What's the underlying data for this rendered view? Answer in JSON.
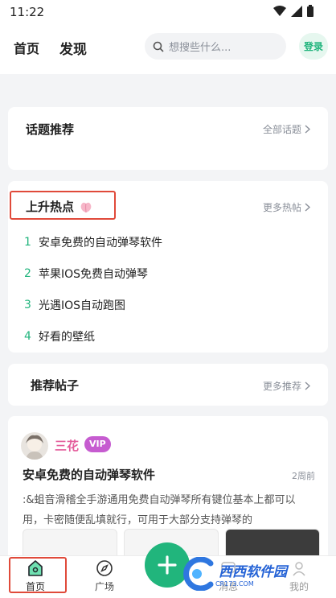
{
  "status": {
    "time": "11:22"
  },
  "header": {
    "tabs": [
      {
        "label": "首页"
      },
      {
        "label": "发现"
      }
    ],
    "search_placeholder": "想搜些什么...",
    "login": "登录"
  },
  "topics": {
    "title": "话题推荐",
    "more": "全部话题"
  },
  "hot": {
    "title": "上升热点",
    "more": "更多热帖",
    "items": [
      {
        "num": "1",
        "text": "安卓免费的自动弹琴软件"
      },
      {
        "num": "2",
        "text": "苹果IOS免费自动弹琴"
      },
      {
        "num": "3",
        "text": "光遇IOS自动跑图"
      },
      {
        "num": "4",
        "text": "好看的壁纸"
      }
    ]
  },
  "recommend": {
    "title": "推荐帖子",
    "more": "更多推荐"
  },
  "post": {
    "author": "三花",
    "badge": "VIP",
    "title": "安卓免费的自动弹琴软件",
    "time": "2周前",
    "body": ":&蛆音滑稽全手游通用免费自动弹琴所有键位基本上都可以用，卡密随便乱填就行，可用于大部分支持弹琴的"
  },
  "bottom_nav": {
    "items": [
      {
        "label": "首页"
      },
      {
        "label": "广场"
      },
      {
        "label": "消息"
      },
      {
        "label": "我的"
      }
    ]
  },
  "watermark": {
    "text": "西西软件园",
    "sub": "CR173.COM"
  },
  "colors": {
    "accent": "#20b47c",
    "highlight": "#e04a3a",
    "vip": "#c65cd0",
    "author": "#e45c9b"
  }
}
